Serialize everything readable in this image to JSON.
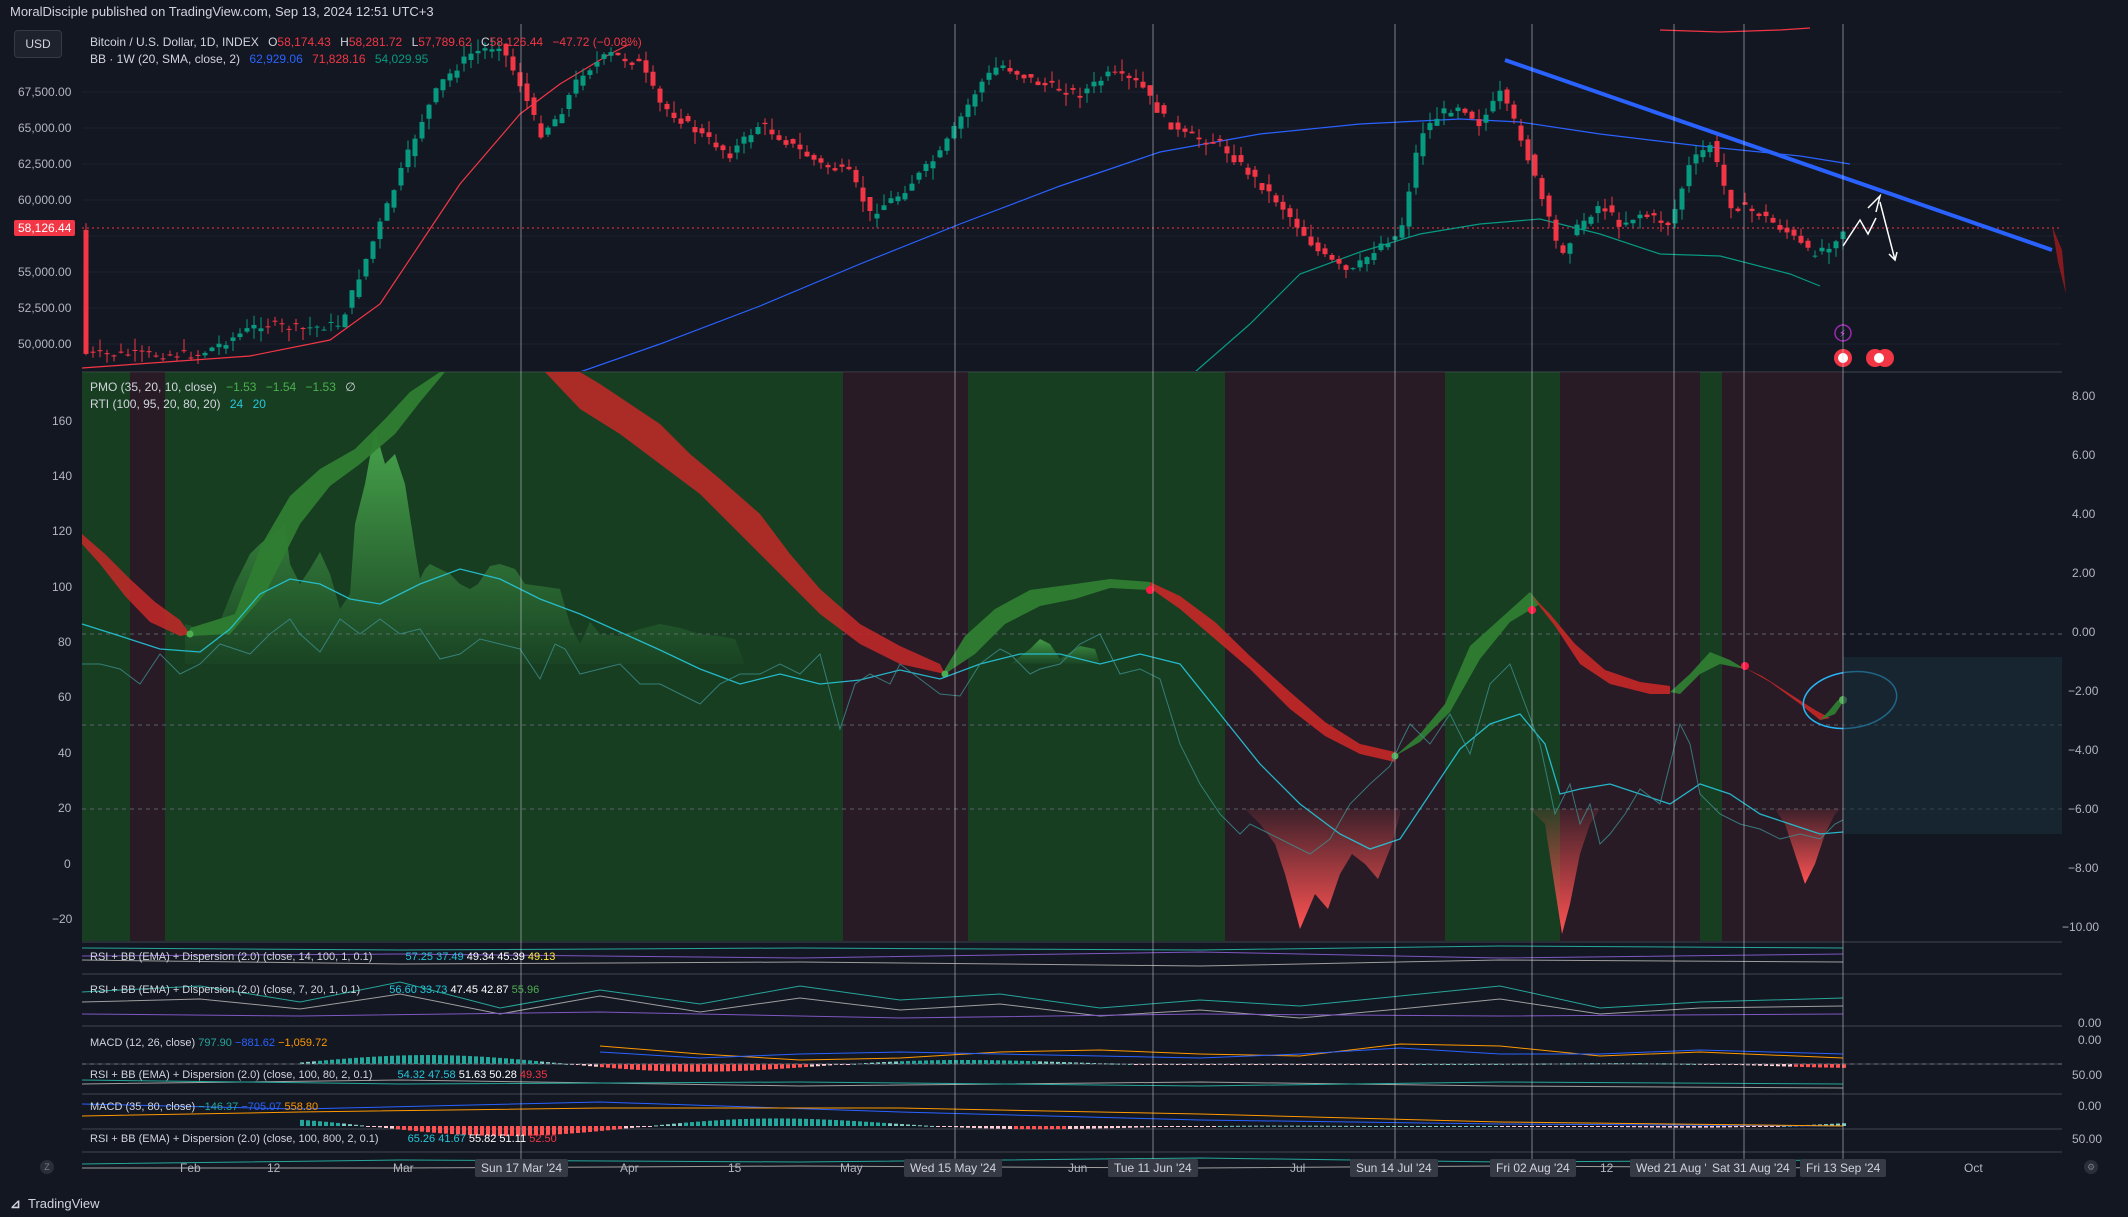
{
  "header": {
    "publisher": "MoralDisciple published on TradingView.com, Sep 13, 2024 12:51 UTC+3"
  },
  "currency_button": "USD",
  "main_legend": {
    "symbol": "Bitcoin / U.S. Dollar, 1D, INDEX",
    "open_label": "O",
    "open": "58,174.43",
    "high_label": "H",
    "high": "58,281.72",
    "low_label": "L",
    "low": "57,789.62",
    "close_label": "C",
    "close": "58,126.44",
    "change": "−47.72 (−0.08%)",
    "bb_label": "BB · 1W (20, SMA, close, 2)",
    "bb_basis": "62,929.06",
    "bb_upper": "71,828.16",
    "bb_lower": "54,029.95"
  },
  "price_axis": {
    "ticks": [
      "67,500.00",
      "65,000.00",
      "62,500.00",
      "60,000.00",
      "55,000.00",
      "52,500.00",
      "50,000.00"
    ],
    "last_price": "58,126.44"
  },
  "pmo_legend": {
    "label": "PMO (35, 20, 10, close)",
    "v1": "−1.53",
    "v2": "−1.54",
    "v3": "−1.53",
    "v4": "∅"
  },
  "rti_legend": {
    "label": "RTI (100, 95, 20, 80, 20)",
    "v1": "24",
    "v2": "20"
  },
  "left_axis_ticks": [
    "160",
    "140",
    "120",
    "100",
    "80",
    "60",
    "40",
    "20",
    "0",
    "−20"
  ],
  "right_axis_ticks": [
    "8.00",
    "6.00",
    "4.00",
    "2.00",
    "0.00",
    "−2.00",
    "−4.00",
    "−6.00",
    "−8.00",
    "−10.00"
  ],
  "sub_panes": [
    {
      "label": "RSI + BB (EMA) + Dispersion (2.0) (close, 14, 100, 1, 0.1)",
      "values": [
        "57.25",
        "37.49",
        "49.34",
        "45.39",
        "49.13"
      ]
    },
    {
      "label": "RSI + BB (EMA) + Dispersion (2.0) (close, 7, 20, 1, 0.1)",
      "values": [
        "56.60",
        "33.73",
        "47.45",
        "42.87",
        "55.96"
      ],
      "axis": "0.00"
    },
    {
      "label": "MACD (12, 26, close)",
      "values": [
        "797.90",
        "−881.62",
        "−1,059.72"
      ],
      "axis": "0.00"
    },
    {
      "label": "RSI + BB (EMA) + Dispersion (2.0) (close, 100, 80, 2, 0.1)",
      "values": [
        "54.32",
        "47.58",
        "51.63",
        "50.28",
        "49.35"
      ],
      "axis": "50.00"
    },
    {
      "label": "MACD (35, 80, close)",
      "values": [
        "−146.37",
        "−705.07",
        "558.80"
      ],
      "axis": "0.00"
    },
    {
      "label": "RSI + BB (EMA) + Dispersion (2.0) (close, 100, 800, 2, 0.1)",
      "values": [
        "65.26",
        "41.67",
        "55.82",
        "51.11",
        "52.50"
      ],
      "axis": "50.00"
    }
  ],
  "time_axis": {
    "labels": [
      "Feb",
      "12",
      "Mar",
      "Apr",
      "15",
      "May",
      "Jun",
      "Jul",
      "12",
      "Oct"
    ],
    "highlighted": [
      "Sun 17 Mar '24",
      "Wed 15 May '24",
      "Tue 11 Jun '24",
      "Sun 14 Jul '24",
      "Fri 02 Aug '24",
      "Wed 21 Aug '24",
      "Sat 31 Aug '24",
      "Fri 13 Sep '24"
    ]
  },
  "footer": {
    "logo_text": "TradingView"
  },
  "colors": {
    "bg": "#131722",
    "up": "#089981",
    "down": "#f23645",
    "trendline": "#2962ff",
    "bb_basis": "#2962ff",
    "green_zone": "#1b5e20",
    "red_zone": "#4a1c26"
  }
}
